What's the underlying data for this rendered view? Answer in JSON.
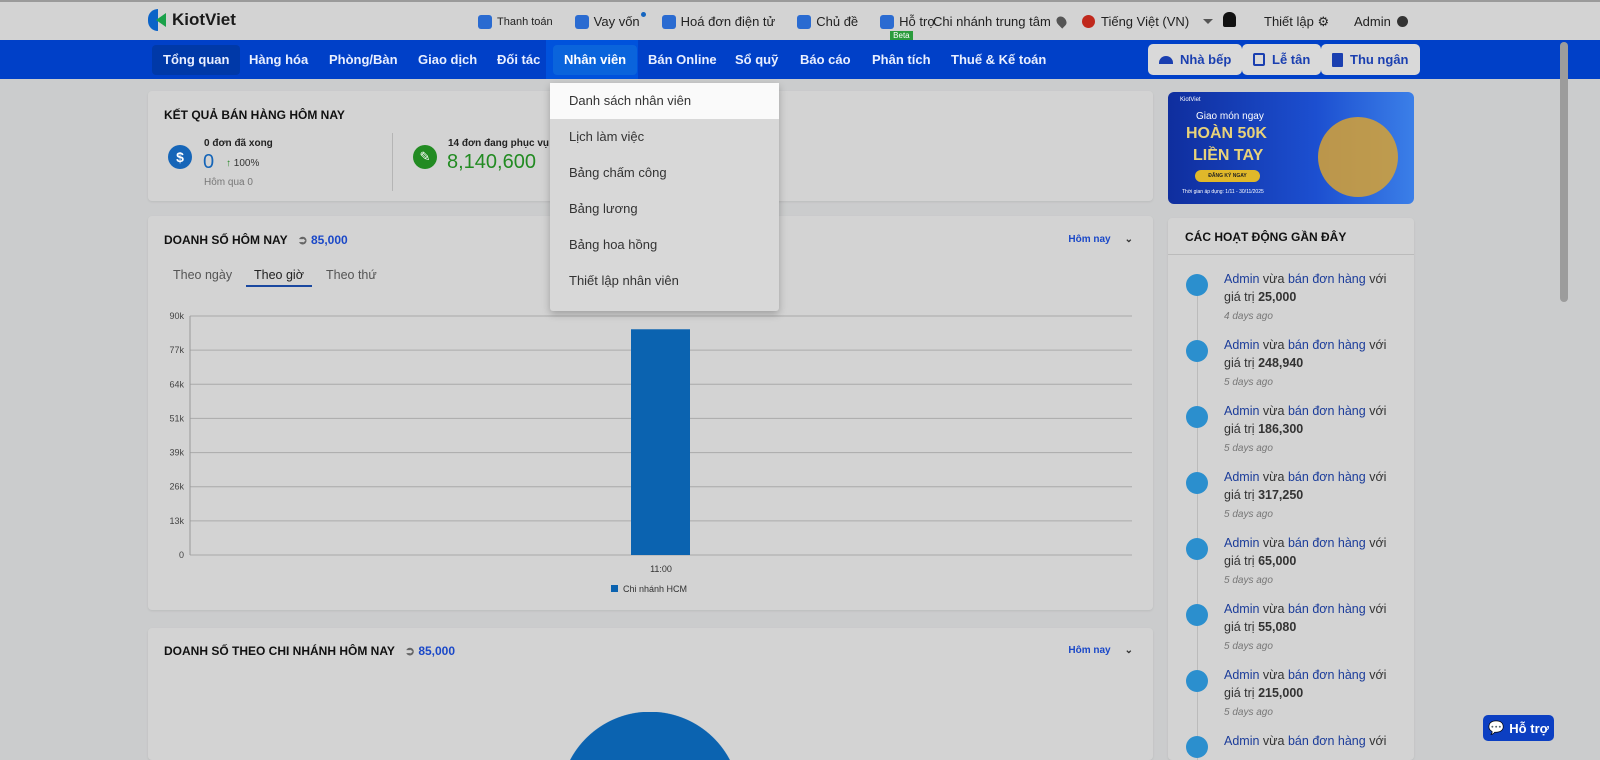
{
  "brand": "KiotViet",
  "top_links": [
    {
      "label": "Thanh toán",
      "icon": "wallet-icon"
    },
    {
      "label": "Vay vốn",
      "icon": "money-bag-icon"
    },
    {
      "label": "Hoá đơn điện tử",
      "icon": "invoice-icon"
    },
    {
      "label": "Chủ đề",
      "icon": "palette-icon"
    },
    {
      "label": "Hỗ trợ",
      "icon": "chat-icon",
      "badge": "Beta"
    }
  ],
  "branch": "Chi nhánh trung tâm",
  "language": "Tiếng Việt (VN)",
  "settings": "Thiết lập",
  "user": "Admin",
  "nav": [
    "Tổng quan",
    "Hàng hóa",
    "Phòng/Bàn",
    "Giao dịch",
    "Đối tác",
    "Nhân viên",
    "Bán Online",
    "Sổ quỹ",
    "Báo cáo",
    "Phân tích",
    "Thuế & Kế toán"
  ],
  "nav_buttons": [
    "Nhà bếp",
    "Lễ tân",
    "Thu ngân"
  ],
  "dropdown": [
    "Danh sách nhân viên",
    "Lịch làm việc",
    "Bảng chấm công",
    "Bảng lương",
    "Bảng hoa hồng",
    "Thiết lập nhân viên"
  ],
  "sales_result": {
    "title": "KẾT QUẢ BÁN HÀNG HÔM NAY",
    "done_label": "0 đơn đã xong",
    "done_value": "0",
    "change": "100%",
    "yesterday": "Hôm qua 0",
    "serving_label": "14 đơn đang phục vụ",
    "serving_value": "8,140,600"
  },
  "revenue": {
    "title": "DOANH SỐ HÔM NAY",
    "total": "85,000",
    "period": "Hôm nay",
    "tabs": [
      "Theo ngày",
      "Theo giờ",
      "Theo thứ"
    ]
  },
  "chart_data": {
    "type": "bar",
    "categories": [
      "11:00"
    ],
    "series": [
      {
        "name": "Chi nhánh HCM",
        "values": [
          85000
        ],
        "color": "#0b63b0"
      }
    ],
    "ylim": [
      0,
      90000
    ],
    "yticks": [
      "0",
      "13k",
      "26k",
      "39k",
      "51k",
      "64k",
      "77k",
      "90k"
    ],
    "legend": "bottom"
  },
  "branch_revenue": {
    "title": "DOANH SỐ THEO CHI NHÁNH HÔM NAY",
    "total": "85,000",
    "period": "Hôm nay"
  },
  "banner": {
    "brand": "KiotViet",
    "line1": "Giao món ngay",
    "line2": "HOÀN 50K",
    "line3": "LIỀN TAY",
    "cta": "ĐĂNG KÝ NGAY",
    "period": "Thời gian áp dụng: 1/11 - 30/11/2025"
  },
  "activities": {
    "title": "CÁC HOẠT ĐỘNG GẦN ĐÂY",
    "actor": "Admin",
    "verb": "vừa",
    "action": "bán đơn hàng",
    "suffix": "với",
    "value_label": "giá trị",
    "items": [
      {
        "value": "25,000",
        "ago": "4 days ago"
      },
      {
        "value": "248,940",
        "ago": "5 days ago"
      },
      {
        "value": "186,300",
        "ago": "5 days ago"
      },
      {
        "value": "317,250",
        "ago": "5 days ago"
      },
      {
        "value": "65,000",
        "ago": "5 days ago"
      },
      {
        "value": "55,080",
        "ago": "5 days ago"
      },
      {
        "value": "215,000",
        "ago": "5 days ago"
      },
      {
        "value": "",
        "ago": ""
      }
    ]
  },
  "support_button": "Hỗ trợ"
}
